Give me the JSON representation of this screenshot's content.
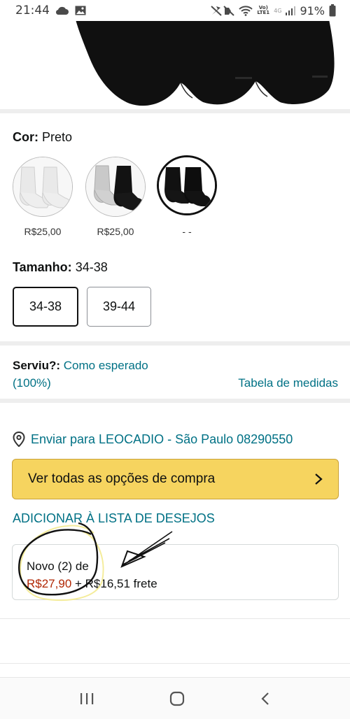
{
  "status_bar": {
    "time": "21:44",
    "battery": "91%",
    "network_top": "Vo)",
    "network_bottom": "LTE1",
    "net_type": "4G",
    "icons": [
      "cloud-icon",
      "image-icon",
      "mute-icon",
      "wifi-icon",
      "signal-icon",
      "battery-icon"
    ]
  },
  "color_section": {
    "label": "Cor:",
    "value": "Preto",
    "swatches": [
      {
        "name": "white-socks",
        "price": "R$25,00"
      },
      {
        "name": "gray-black-socks",
        "price": "R$25,00"
      },
      {
        "name": "black-socks",
        "price": "- -",
        "selected": true
      }
    ]
  },
  "size_section": {
    "label": "Tamanho:",
    "value": "34-38",
    "options": [
      {
        "label": "34-38",
        "selected": true
      },
      {
        "label": "39-44",
        "selected": false
      }
    ]
  },
  "fit_section": {
    "label": "Serviu?:",
    "value_line1": "Como esperado",
    "value_line2": "(100%)",
    "size_chart_link": "Tabela de medidas"
  },
  "delivery": {
    "text": "Enviar para LEOCADIO - São Paulo 08290550"
  },
  "buy_button": {
    "label": "Ver todas as opções de compra"
  },
  "wishlist": {
    "label": "ADICIONAR À LISTA DE DESEJOS"
  },
  "offer": {
    "line1": "Novo (2) de",
    "price": "R$27,90",
    "shipping": " + R$16,51 frete"
  },
  "colors": {
    "accent_link": "#007185",
    "buy_button": "#f6d45f",
    "price": "#b12704"
  }
}
